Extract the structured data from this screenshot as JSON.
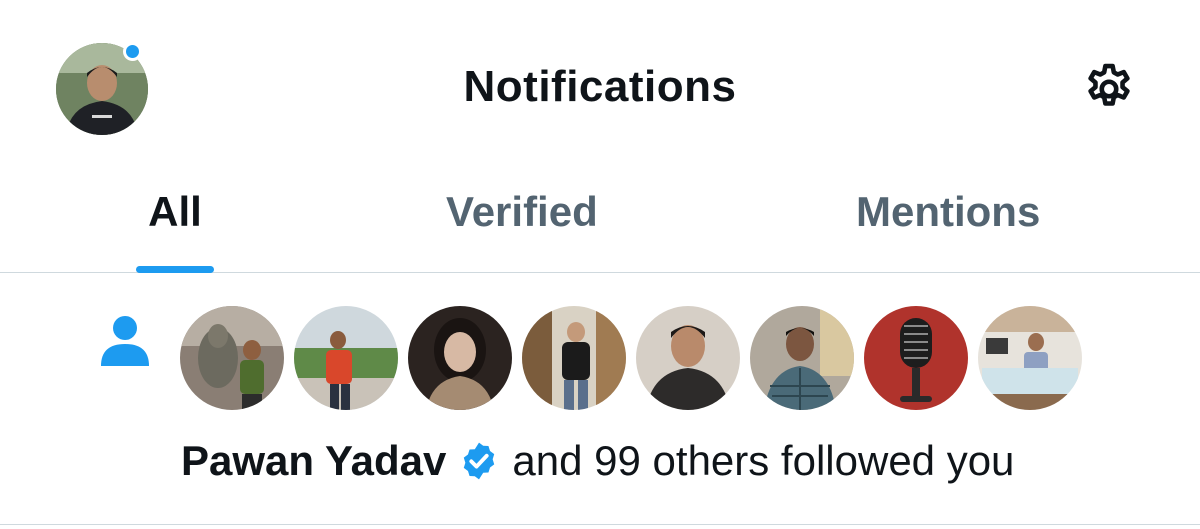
{
  "header": {
    "title": "Notifications",
    "avatar_icon": "profile-avatar",
    "settings_icon": "gear-icon",
    "unread_dot_color": "#1d9bf0"
  },
  "tabs": [
    {
      "label": "All",
      "active": true
    },
    {
      "label": "Verified",
      "active": false
    },
    {
      "label": "Mentions",
      "active": false
    }
  ],
  "notification": {
    "type_icon": "person-icon",
    "name": "Pawan Yadav",
    "verified": true,
    "text": "and 99 others followed you",
    "follower_avatars": [
      "avatar-statue-photo",
      "avatar-red-shirt-photo",
      "avatar-woman-selfie-photo",
      "avatar-leather-jacket-photo",
      "avatar-hoodie-selfie-photo",
      "avatar-checked-shirt-photo",
      "avatar-microphone-image",
      "avatar-office-desk-photo"
    ]
  },
  "colors": {
    "accent": "#1d9bf0",
    "text_primary": "#0f1419",
    "text_secondary": "#536471",
    "divider": "#cfd9de"
  }
}
